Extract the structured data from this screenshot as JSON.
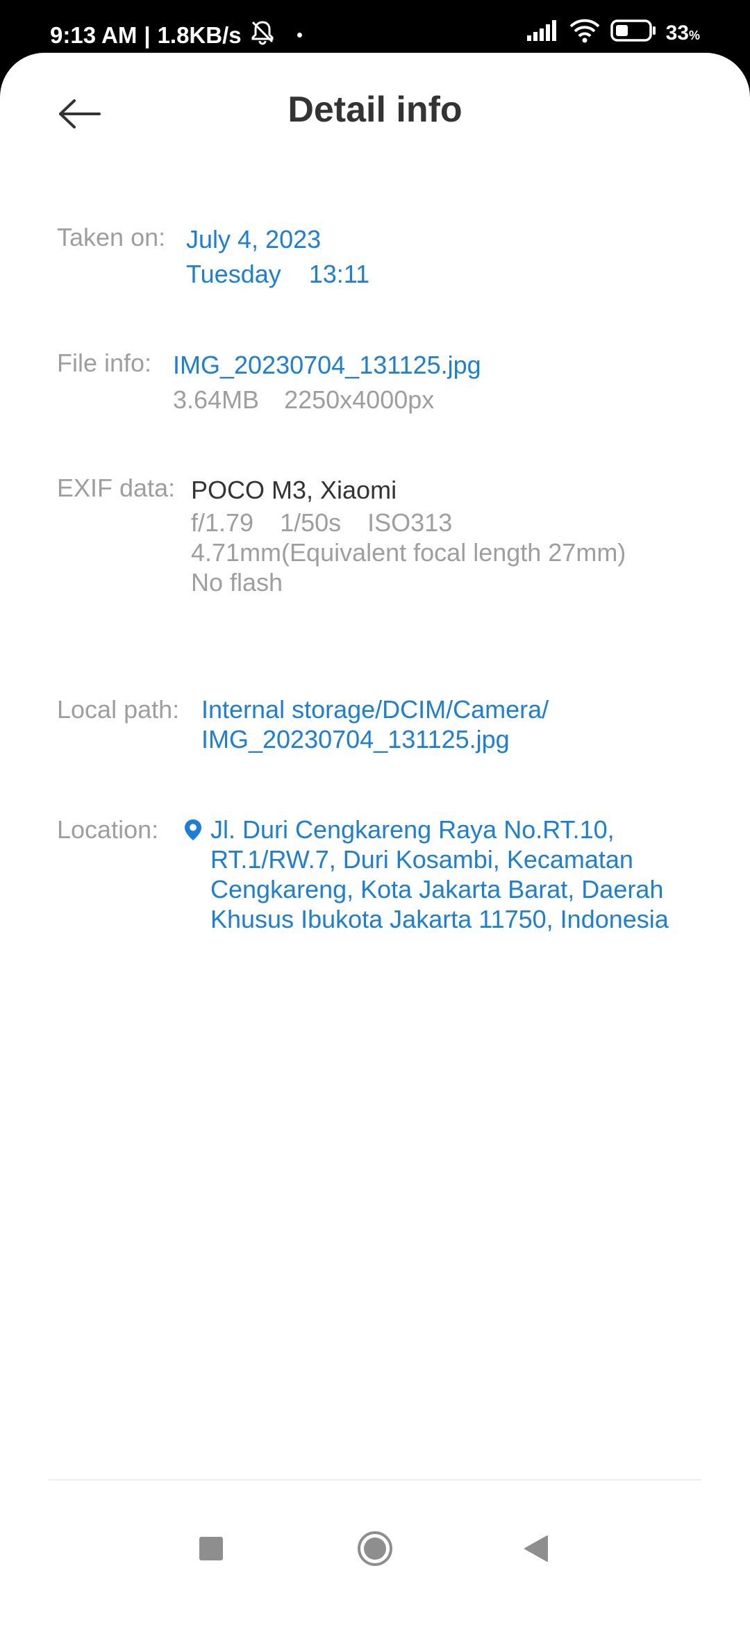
{
  "status_bar": {
    "time": "9:13 AM",
    "separator": "|",
    "speed": "1.8KB/s",
    "battery": "33",
    "battery_unit": "%"
  },
  "header": {
    "title": "Detail info"
  },
  "taken_on": {
    "label": "Taken on:",
    "date": "July 4, 2023",
    "day": "Tuesday",
    "time": "13:11"
  },
  "file_info": {
    "label": "File info:",
    "filename": "IMG_20230704_131125.jpg",
    "size": "3.64MB",
    "resolution": "2250x4000px"
  },
  "exif": {
    "label": "EXIF data:",
    "device": "POCO M3, Xiaomi",
    "aperture": "f/1.79",
    "shutter": "1/50s",
    "iso": "ISO313",
    "focal": "4.71mm(Equivalent focal length 27mm)",
    "flash": "No flash"
  },
  "local_path": {
    "label": "Local path:",
    "line1": "Internal storage/DCIM/Camera/",
    "line2": "IMG_20230704_131125.jpg"
  },
  "location": {
    "label": "Location:",
    "lines": [
      "Jl. Duri Cengkareng Raya No.RT.10,",
      "RT.1/RW.7, Duri Kosambi, Kecamatan",
      "Cengkareng, Kota Jakarta Barat, Daerah",
      "Khusus Ibukota Jakarta 11750, Indonesia"
    ]
  },
  "colors": {
    "accent": "#1b7ed8",
    "label": "#9e9e9e",
    "title": "#333333"
  },
  "icons": {
    "back": "arrow-left-icon",
    "pin": "location-pin-icon",
    "recents": "square-icon",
    "home": "circle-icon",
    "nav_back": "triangle-back-icon"
  }
}
